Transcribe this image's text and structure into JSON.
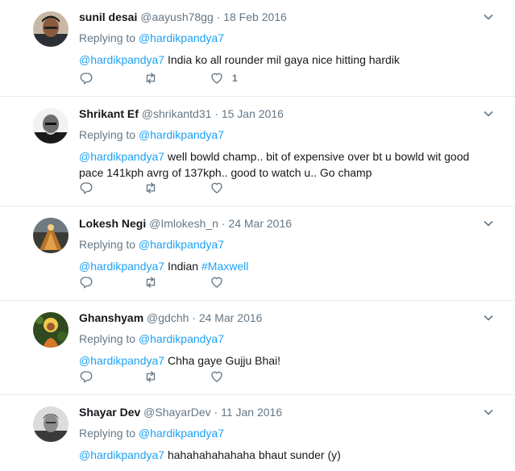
{
  "colors": {
    "link": "#1da1f2",
    "muted": "#657786",
    "text": "#14171a",
    "divider": "#e6ecf0"
  },
  "tweets": [
    {
      "name": "sunil desai",
      "handle": "@aayush78gg",
      "dot": "·",
      "date": "18 Feb 2016",
      "replying_prefix": "Replying to ",
      "replying_to": "@hardikpandya7",
      "mention": "@hardikpandya7",
      "text": " India ko all rounder mil gaya nice hitting hardik",
      "like_count": "1",
      "avatar_icon": "profile-photo"
    },
    {
      "name": "Shrikant Ef",
      "handle": "@shrikantd31",
      "dot": "·",
      "date": "15 Jan 2016",
      "replying_prefix": "Replying to ",
      "replying_to": "@hardikpandya7",
      "mention": "@hardikpandya7",
      "text": " well bowld champ.. bit of expensive over bt u bowld wit good pace 141kph avrg of 137kph.. good to watch u.. Go champ",
      "like_count": "",
      "avatar_icon": "profile-photo"
    },
    {
      "name": "Lokesh Negi",
      "handle": "@Imlokesh_n",
      "dot": "·",
      "date": "24 Mar 2016",
      "replying_prefix": "Replying to ",
      "replying_to": "@hardikpandya7",
      "mention": "@hardikpandya7",
      "text": " Indian ",
      "hashtag": "#Maxwell",
      "like_count": "",
      "avatar_icon": "profile-photo"
    },
    {
      "name": "Ghanshyam",
      "handle": "@gdchh",
      "dot": "·",
      "date": "24 Mar 2016",
      "replying_prefix": "Replying to ",
      "replying_to": "@hardikpandya7",
      "mention": "@hardikpandya7",
      "text": " Chha gaye Gujju Bhai!",
      "like_count": "",
      "avatar_icon": "profile-photo"
    },
    {
      "name": "Shayar Dev",
      "handle": "@ShayarDev",
      "dot": "·",
      "date": "11 Jan 2016",
      "replying_prefix": "Replying to ",
      "replying_to": "@hardikpandya7",
      "mention": "@hardikpandya7",
      "text": " hahahahahahaha bhaut sunder (y)",
      "like_count": "",
      "avatar_icon": "profile-photo"
    }
  ]
}
